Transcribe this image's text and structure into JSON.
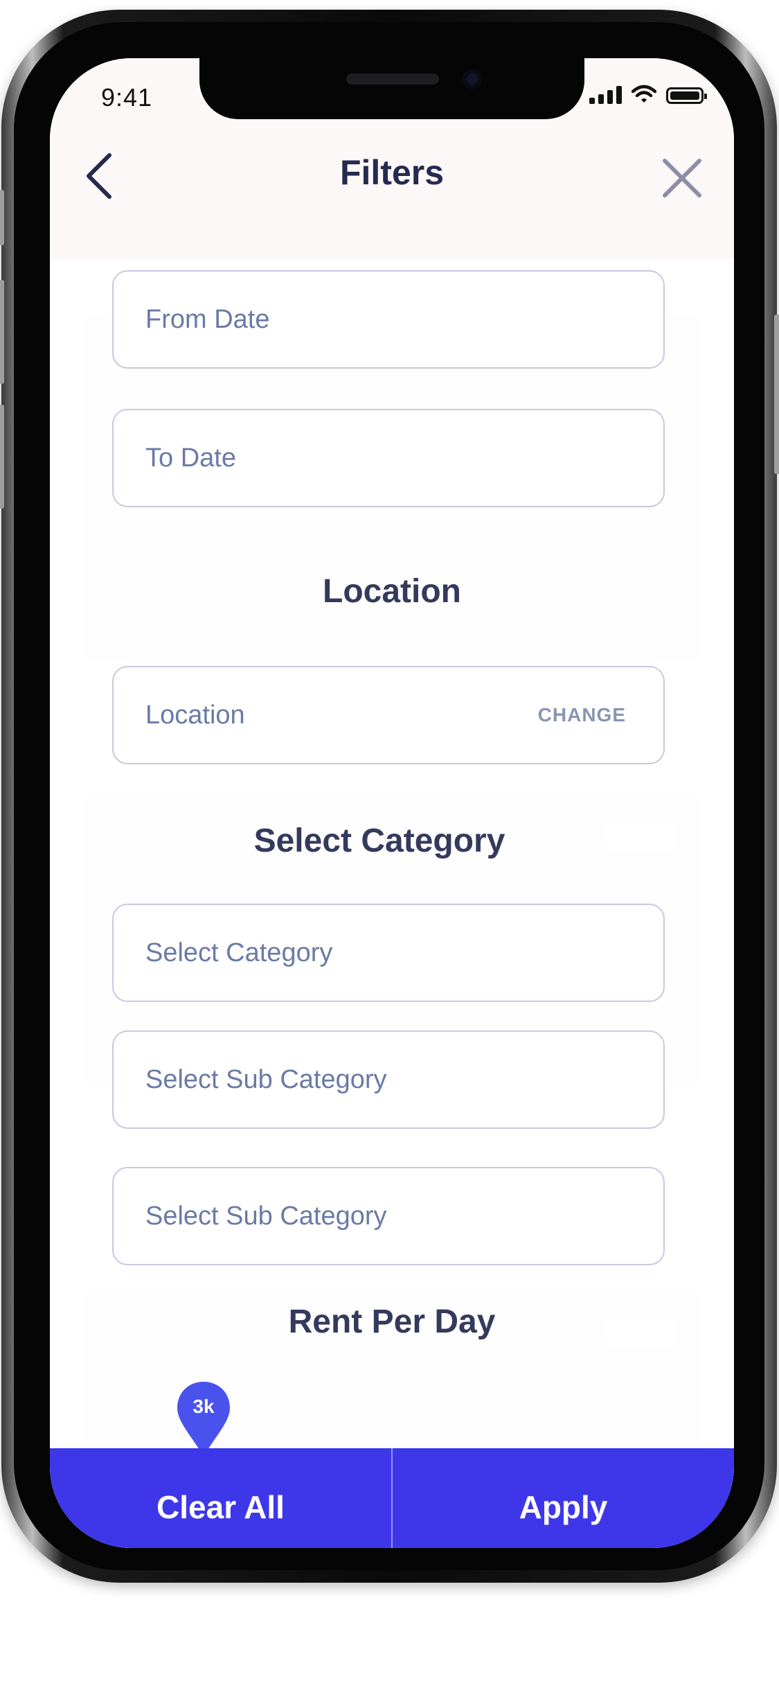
{
  "status_bar": {
    "time": "9:41"
  },
  "header": {
    "title": "Filters"
  },
  "date_fields": [
    {
      "placeholder": "From Date"
    },
    {
      "placeholder": "To Date"
    }
  ],
  "location": {
    "title": "Location",
    "placeholder": "Location",
    "change_label": "CHANGE"
  },
  "category": {
    "title": "Select Category",
    "fields": [
      {
        "placeholder": "Select Category"
      },
      {
        "placeholder": "Select Sub Category"
      },
      {
        "placeholder": "Select Sub Category"
      }
    ]
  },
  "rent": {
    "title": "Rent Per Day",
    "slider_value_label": "3k"
  },
  "footer": {
    "clear_label": "Clear All",
    "apply_label": "Apply"
  },
  "colors": {
    "primary": "#3e37ea",
    "title_text": "#252a50",
    "field_text": "#6b7aa6",
    "field_border": "#c7c9e0"
  }
}
